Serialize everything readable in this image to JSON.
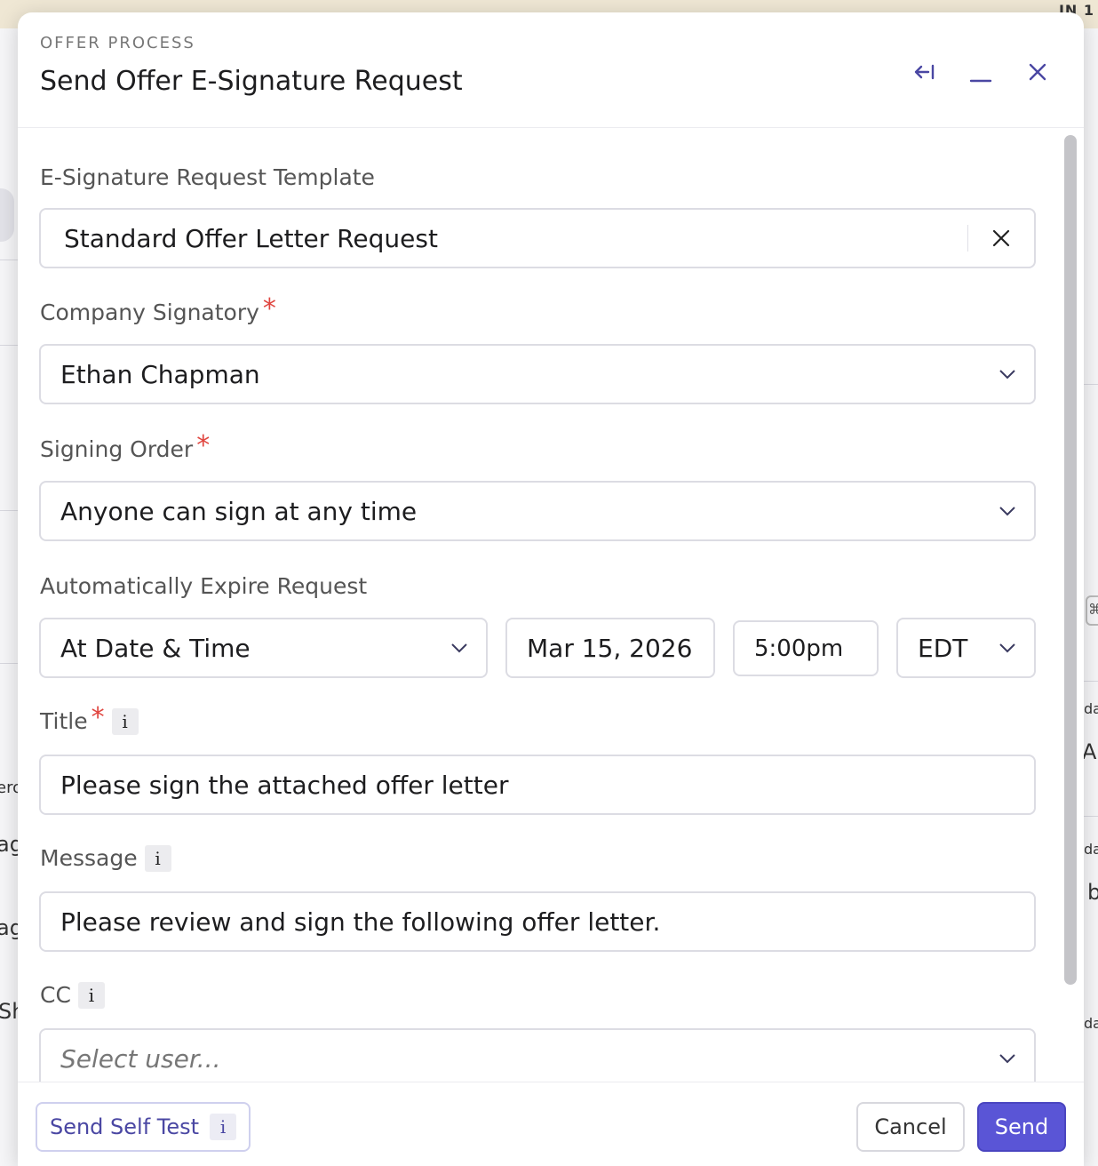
{
  "background": {
    "top_right_text": "IN 1",
    "left_fragments": [
      "ero",
      "ag",
      "ag",
      "Sh"
    ],
    "right_fragments": [
      "da",
      "A",
      "da",
      "b",
      "da"
    ],
    "right_chip_glyph": "⌘"
  },
  "modal": {
    "eyebrow": "OFFER PROCESS",
    "title": "Send Offer E-Signature Request"
  },
  "form": {
    "template": {
      "label": "E-Signature Request Template",
      "value": "Standard Offer Letter Request"
    },
    "signatory": {
      "label": "Company Signatory",
      "required_mark": "*",
      "value": "Ethan Chapman"
    },
    "signing_order": {
      "label": "Signing Order",
      "required_mark": "*",
      "value": "Anyone can sign at any time"
    },
    "expire": {
      "label": "Automatically Expire Request",
      "mode": "At Date & Time",
      "date": "Mar 15, 2026",
      "time": "5:00pm",
      "timezone": "EDT"
    },
    "title_field": {
      "label": "Title",
      "required_mark": "*",
      "info": "i",
      "value": "Please sign the attached offer letter"
    },
    "message": {
      "label": "Message",
      "info": "i",
      "value": "Please review and sign the following offer letter."
    },
    "cc": {
      "label": "CC",
      "info": "i",
      "placeholder": "Select user..."
    }
  },
  "footer": {
    "self_test_label": "Send Self Test",
    "self_test_info": "i",
    "cancel_label": "Cancel",
    "send_label": "Send"
  },
  "colors": {
    "accent": "#5a55d6",
    "required": "#e0453f",
    "icon": "#4a47a3"
  },
  "icons": {
    "collapse": "arrow-left-bar-icon",
    "minimize": "minimize-icon",
    "close": "close-icon",
    "clear": "clear-x-icon",
    "dropdown": "chevron-down-icon"
  }
}
